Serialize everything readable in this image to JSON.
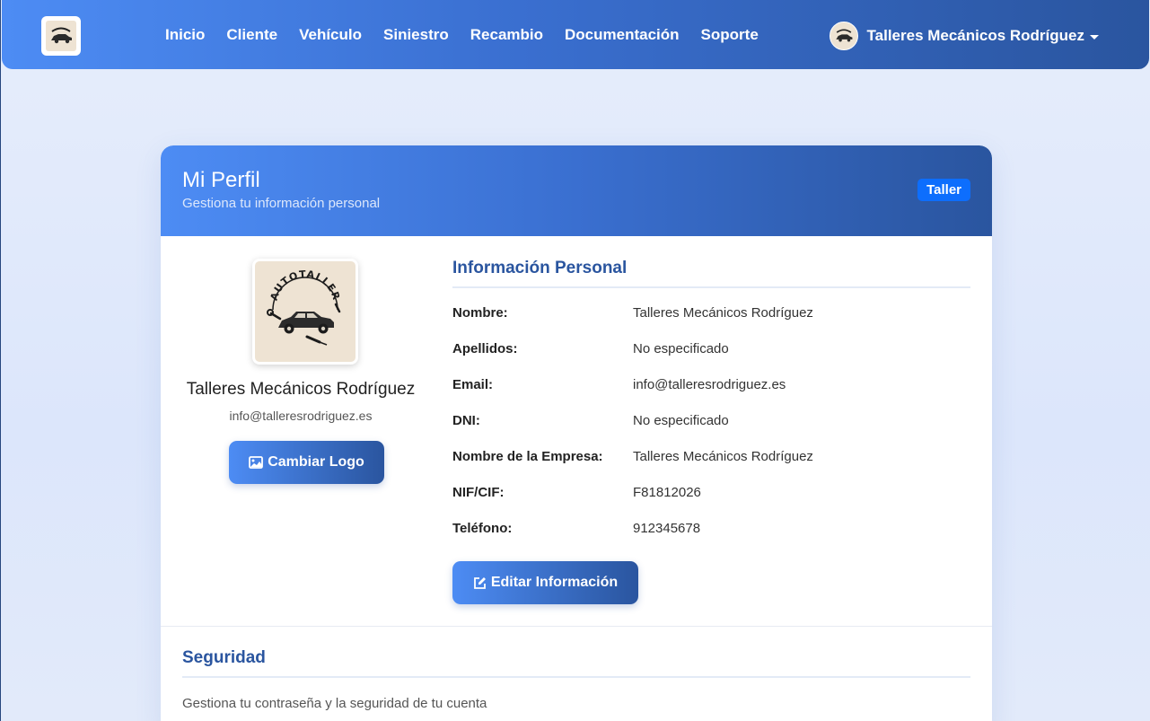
{
  "navbar": {
    "logo_name": "autotaller-logo",
    "links": [
      "Inicio",
      "Cliente",
      "Vehículo",
      "Siniestro",
      "Recambio",
      "Documentación",
      "Soporte"
    ],
    "user": {
      "name": "Talleres Mecánicos Rodríguez"
    }
  },
  "profile": {
    "title": "Mi Perfil",
    "subtitle": "Gestiona tu información personal",
    "role_badge": "Taller",
    "logo_text": "AUTOTALLER",
    "name": "Talleres Mecánicos Rodríguez",
    "email": "info@talleresrodriguez.es",
    "change_logo_label": "Cambiar Logo"
  },
  "info": {
    "title": "Información Personal",
    "rows": [
      {
        "label": "Nombre:",
        "value": "Talleres Mecánicos Rodríguez"
      },
      {
        "label": "Apellidos:",
        "value": "No especificado"
      },
      {
        "label": "Email:",
        "value": "info@talleresrodriguez.es"
      },
      {
        "label": "DNI:",
        "value": "No especificado"
      },
      {
        "label": "Nombre de la Empresa:",
        "value": "Talleres Mecánicos Rodríguez"
      },
      {
        "label": "NIF/CIF:",
        "value": "F81812026"
      },
      {
        "label": "Teléfono:",
        "value": "912345678"
      }
    ],
    "edit_label": "Editar Información"
  },
  "security": {
    "title": "Seguridad",
    "description": "Gestiona tu contraseña y la seguridad de tu cuenta"
  },
  "colors": {
    "primary_start": "#4d8cf4",
    "primary_end": "#2a559f",
    "badge": "#0d6efd"
  }
}
